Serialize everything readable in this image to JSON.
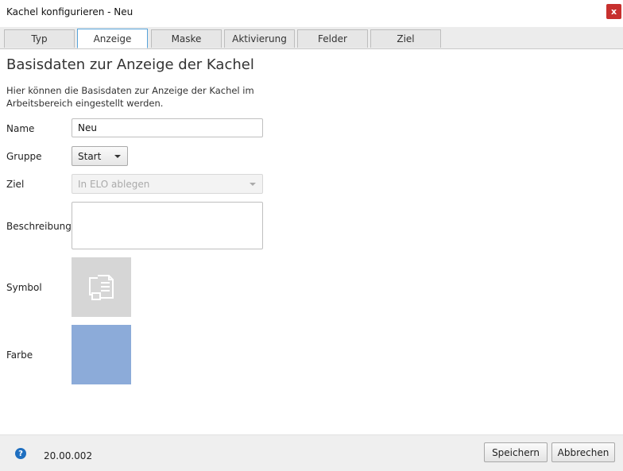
{
  "window": {
    "title": "Kachel konfigurieren - Neu",
    "close_label": "x"
  },
  "tabs": [
    {
      "label": "Typ",
      "active": false
    },
    {
      "label": "Anzeige",
      "active": true
    },
    {
      "label": "Maske",
      "active": false
    },
    {
      "label": "Aktivierung",
      "active": false
    },
    {
      "label": "Felder",
      "active": false
    },
    {
      "label": "Ziel",
      "active": false
    }
  ],
  "main": {
    "heading": "Basisdaten zur Anzeige der Kachel",
    "description": "Hier können die Basisdaten zur Anzeige der Kachel im Arbeitsbereich eingestellt werden.",
    "fields": {
      "name_label": "Name",
      "name_value": "Neu",
      "group_label": "Gruppe",
      "group_value": "Start",
      "target_label": "Ziel",
      "target_value": "In ELO ablegen",
      "description_label": "Beschreibung",
      "description_value": "",
      "symbol_label": "Symbol",
      "symbol_icon": "documents-icon",
      "color_label": "Farbe",
      "color_value": "#8cabd9"
    }
  },
  "footer": {
    "help_icon_label": "?",
    "version": "20.00.002",
    "save_label": "Speichern",
    "cancel_label": "Abbrechen"
  }
}
